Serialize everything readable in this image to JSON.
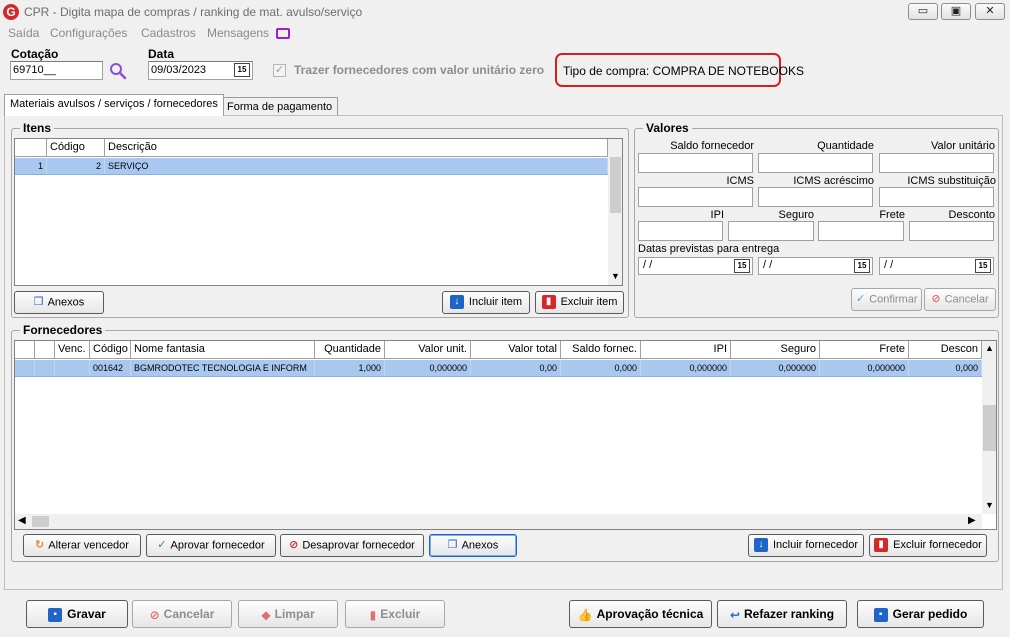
{
  "window": {
    "title": "CPR - Digita mapa de compras / ranking de mat. avulso/serviço",
    "app_icon_letter": "G",
    "controls": {
      "minimize": "▭",
      "restore": "▣",
      "close": "✕"
    }
  },
  "menu": [
    {
      "label": "Saída"
    },
    {
      "label": "Configurações"
    },
    {
      "label": "Cadastros"
    },
    {
      "label": "Mensagens"
    }
  ],
  "header": {
    "cotacao_label": "Cotação",
    "cotacao_value": "69710__",
    "data_label": "Data",
    "data_value": "09/03/2023",
    "calendar_icon_text": "15",
    "trazer_label": "Trazer fornecedores com valor unitário zero",
    "tipo_compra": "Tipo de compra: COMPRA DE NOTEBOOKS"
  },
  "tabs": [
    {
      "label": "Materiais avulsos / serviços / fornecedores",
      "active": true
    },
    {
      "label": "Forma de pagamento",
      "active": false
    }
  ],
  "itens": {
    "title": "Itens",
    "columns": [
      "",
      "Código",
      "Descrição"
    ],
    "rows": [
      {
        "index": "1",
        "codigo": "2",
        "descricao": "SERVIÇO"
      }
    ],
    "anexos_label": "Anexos",
    "incluir_label": "Incluir item",
    "excluir_label": "Excluir item"
  },
  "valores": {
    "title": "Valores",
    "labels": {
      "saldo_fornecedor": "Saldo fornecedor",
      "quantidade": "Quantidade",
      "valor_unitario": "Valor unitário",
      "icms": "ICMS",
      "icms_acrescimo": "ICMS acréscimo",
      "icms_substituicao": "ICMS substituição",
      "ipi": "IPI",
      "seguro": "Seguro",
      "frete": "Frete",
      "desconto": "Desconto",
      "datas_previstas": "Datas previstas para entrega"
    },
    "date_placeholder": " /  /",
    "confirmar_label": "Confirmar",
    "cancelar_label": "Cancelar"
  },
  "fornecedores": {
    "title": "Fornecedores",
    "columns": [
      "",
      "",
      "Venc.",
      "Código",
      "Nome fantasia",
      "Quantidade",
      "Valor unit.",
      "Valor total",
      "Saldo fornec.",
      "IPI",
      "Seguro",
      "Frete",
      "Descon"
    ],
    "rows": [
      {
        "venc": "",
        "codigo": "001642",
        "nome": "BGMRODOTEC TECNOLOGIA E INFORM",
        "quantidade": "1,000",
        "valor_unit": "0,000000",
        "valor_total": "0,00",
        "saldo": "0,000",
        "ipi": "0,000000",
        "seguro": "0,000000",
        "frete": "0,000000",
        "desconto": "0,000"
      }
    ],
    "buttons": {
      "alterar": "Alterar vencedor",
      "aprovar": "Aprovar fornecedor",
      "desaprovar": "Desaprovar fornecedor",
      "anexos": "Anexos",
      "incluir": "Incluir fornecedor",
      "excluir": "Excluir fornecedor"
    }
  },
  "footer": {
    "gravar": "Gravar",
    "cancelar": "Cancelar",
    "limpar": "Limpar",
    "excluir": "Excluir",
    "aprovacao_tecnica": "Aprovação técnica",
    "refazer_ranking": "Refazer ranking",
    "gerar_pedido": "Gerar pedido"
  },
  "colors": {
    "selection": "#a9c8ef",
    "highlight_border": "#d31f1f",
    "accent_blue": "#1f64c8"
  }
}
